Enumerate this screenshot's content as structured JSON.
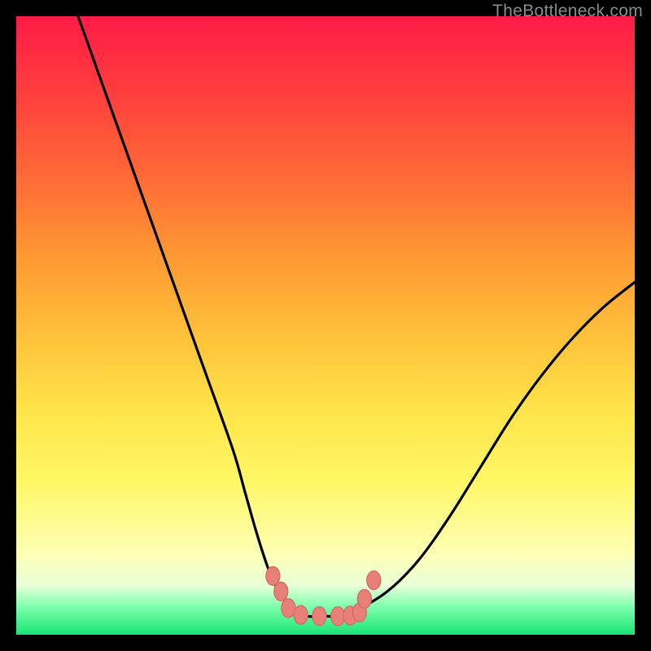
{
  "watermark": "TheBottleneck.com",
  "chart_data": {
    "type": "line",
    "title": "",
    "xlabel": "",
    "ylabel": "",
    "xlim": [
      0,
      100
    ],
    "ylim": [
      0,
      100
    ],
    "grid": false,
    "legend": false,
    "series": [
      {
        "name": "bottleneck-curve",
        "x": [
          10,
          15,
          20,
          25,
          30,
          35,
          37,
          39,
          41,
          43,
          45,
          47,
          50,
          52,
          55,
          60,
          65,
          70,
          75,
          80,
          85,
          90,
          95,
          100
        ],
        "y": [
          100,
          86,
          72,
          58,
          44,
          30,
          23,
          16,
          10,
          6,
          4,
          3,
          3,
          3,
          4,
          7,
          12,
          19,
          27,
          35,
          42,
          48,
          53,
          57
        ]
      }
    ],
    "markers": {
      "name": "highlight-points",
      "x": [
        41.5,
        42.8,
        44,
        46,
        49,
        52,
        54,
        55.5,
        56.3,
        57.8
      ],
      "y": [
        9.5,
        7,
        4.3,
        3.2,
        3,
        3,
        3.1,
        3.6,
        5.8,
        8.8
      ]
    }
  }
}
